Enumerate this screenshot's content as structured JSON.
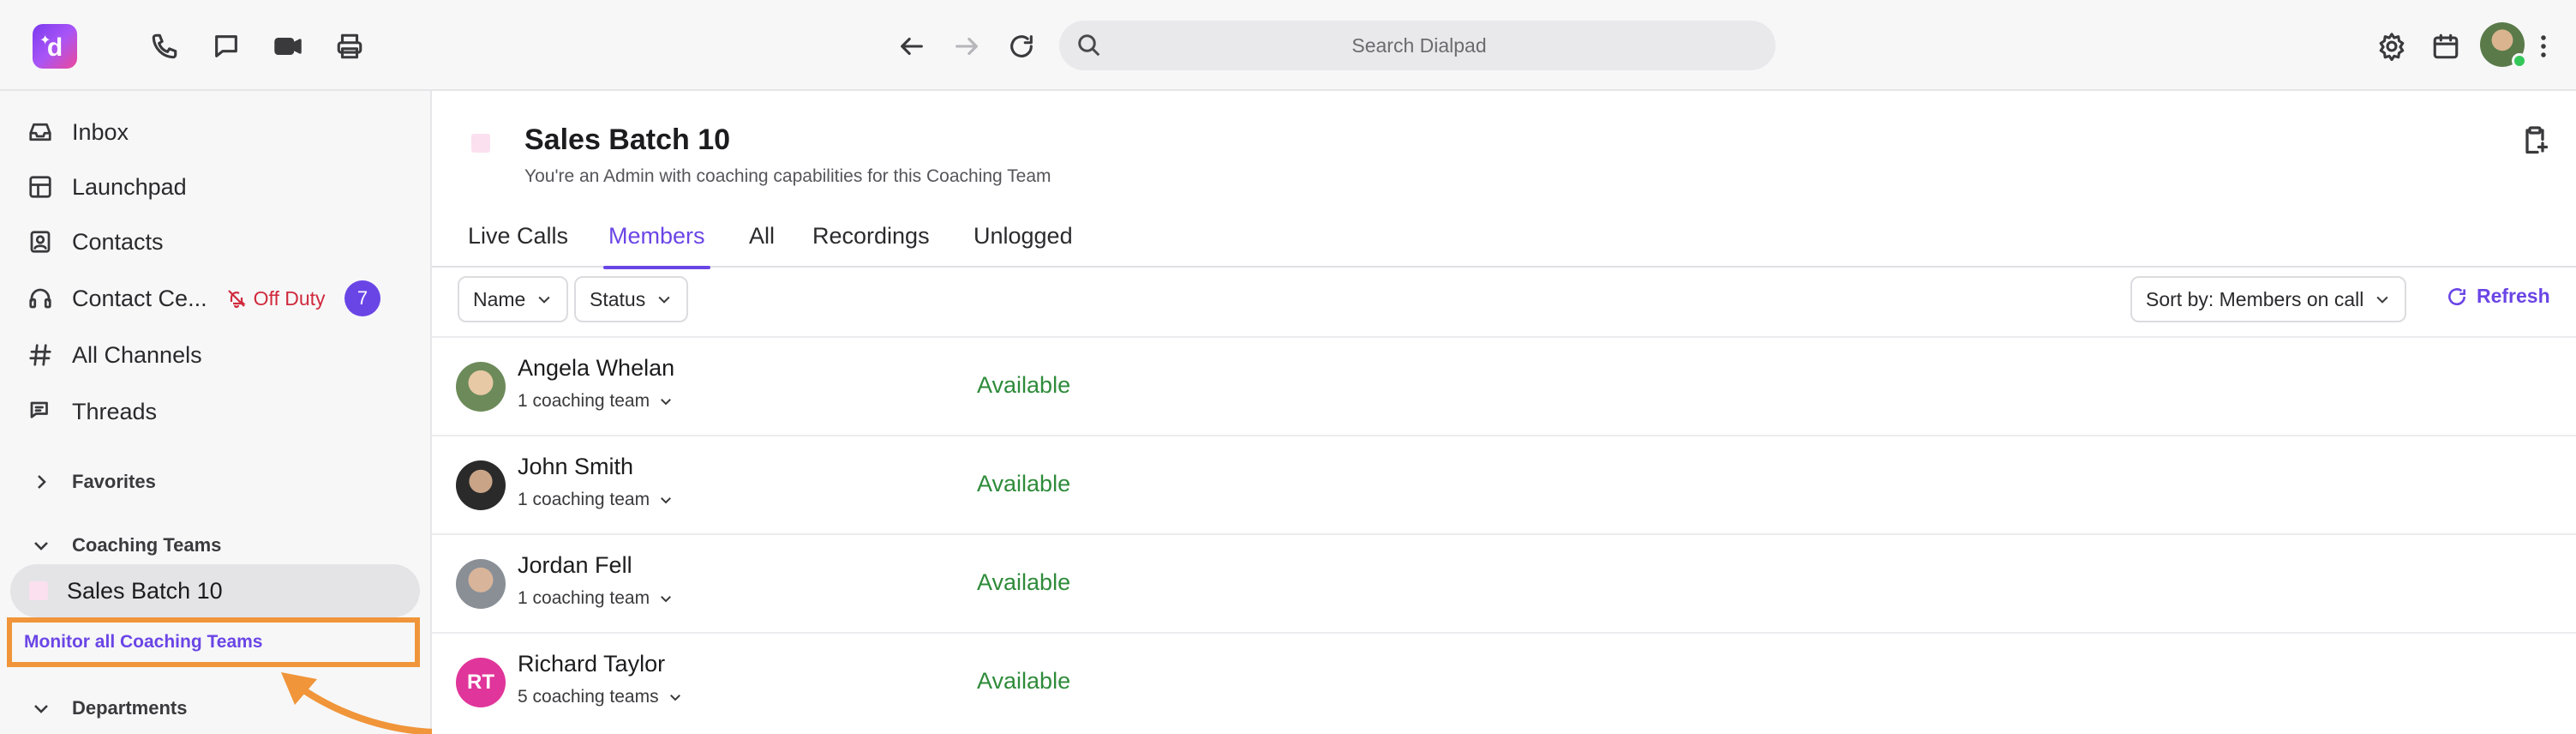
{
  "app": {
    "logo_letter": "d",
    "search_placeholder": "Search Dialpad",
    "accent_color": "#6a45e6"
  },
  "topbar": {
    "left_icons": [
      "phone-icon",
      "chat-bubble-icon",
      "video-camera-icon",
      "printer-icon"
    ],
    "nav_icons": [
      "back-arrow-icon",
      "forward-arrow-icon",
      "reload-icon"
    ],
    "right_icons": [
      "gear-icon",
      "calendar-icon",
      "avatar",
      "more-vertical-icon"
    ]
  },
  "sidebar": {
    "items": [
      {
        "label": "Inbox",
        "icon": "inbox-icon"
      },
      {
        "label": "Launchpad",
        "icon": "launchpad-icon"
      },
      {
        "label": "Contacts",
        "icon": "contacts-icon"
      },
      {
        "label": "Contact Ce...",
        "icon": "headset-icon",
        "status": "Off Duty",
        "badge": "7"
      },
      {
        "label": "All Channels",
        "icon": "hash-icon"
      },
      {
        "label": "Threads",
        "icon": "threads-icon"
      }
    ],
    "favorites_label": "Favorites",
    "coaching_teams_label": "Coaching Teams",
    "team_item": "Sales Batch 10",
    "monitor_link": "Monitor all Coaching Teams",
    "departments_label": "Departments"
  },
  "main": {
    "title": "Sales Batch 10",
    "subtitle": "You're an Admin with coaching capabilities for this Coaching Team",
    "tabs": [
      {
        "label": "Live Calls",
        "active": false
      },
      {
        "label": "Members",
        "active": true
      },
      {
        "label": "All",
        "active": false
      },
      {
        "label": "Recordings",
        "active": false
      },
      {
        "label": "Unlogged",
        "active": false
      }
    ],
    "filters": {
      "name": "Name",
      "status": "Status",
      "sort": "Sort by: Members on call",
      "refresh": "Refresh"
    },
    "members": [
      {
        "name": "Angela Whelan",
        "teams": "1 coaching team",
        "status": "Available",
        "initials": ""
      },
      {
        "name": "John Smith",
        "teams": "1 coaching team",
        "status": "Available",
        "initials": ""
      },
      {
        "name": "Jordan Fell",
        "teams": "1 coaching team",
        "status": "Available",
        "initials": ""
      },
      {
        "name": "Richard Taylor",
        "teams": "5 coaching teams",
        "status": "Available",
        "initials": "RT"
      }
    ]
  }
}
